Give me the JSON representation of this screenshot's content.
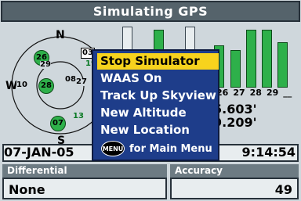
{
  "title": "Simulating GPS",
  "skyview": {
    "north": "N",
    "west": "W",
    "south": "S",
    "satellites": [
      "26",
      "29",
      "03",
      "19",
      "08",
      "27",
      "10",
      "28",
      "07",
      "13"
    ]
  },
  "signal_bars": {
    "labels": [
      "19",
      "26",
      "27",
      "28",
      "29",
      "__"
    ],
    "levels": [
      0.6,
      0.68,
      0.55,
      0.85,
      0.85,
      0.72,
      0.0
    ]
  },
  "position": {
    "lat_partial": "5.603'",
    "lon_partial": "9.209'"
  },
  "status": {
    "date": "07-JAN-05",
    "time": "9:14:54"
  },
  "fields": {
    "differential_label": "Differential",
    "differential_value": "None",
    "accuracy_label": "Accuracy",
    "accuracy_value": "49"
  },
  "menu": {
    "items": [
      "Stop Simulator",
      "WAAS On",
      "Track Up Skyview",
      "New Altitude",
      "New Location"
    ],
    "footer_key": "MENU",
    "footer_text": "for Main Menu"
  },
  "colors": {
    "accent_green": "#2eb04a",
    "menu_blue": "#1e3d8a",
    "selection": "#f7d31d"
  }
}
